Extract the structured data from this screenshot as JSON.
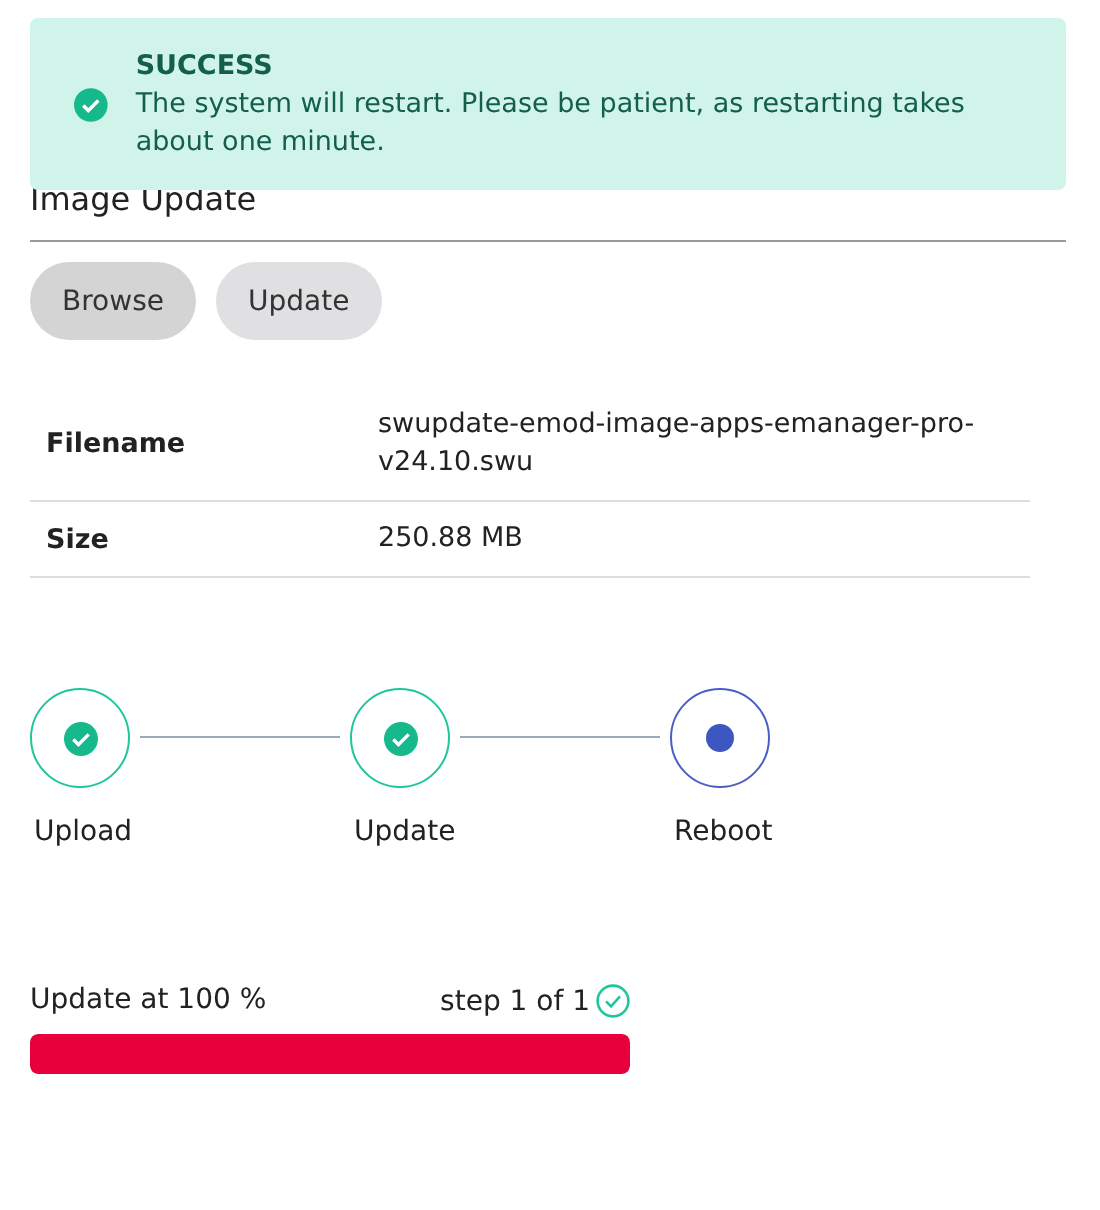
{
  "notification": {
    "title": "SUCCESS",
    "message": "The system will restart. Please be patient, as restarting takes about one minute."
  },
  "heading": "Image Update",
  "buttons": [
    {
      "label": "Browse",
      "pressed": true
    },
    {
      "label": "Update",
      "pressed": false
    }
  ],
  "file_info": [
    {
      "label": "Filename",
      "value": "swupdate-emod-image-apps-emanager-pro-v24.10.swu"
    },
    {
      "label": "Size",
      "value": "250.88 MB"
    }
  ],
  "steps": [
    {
      "label": "Upload",
      "completed": true
    },
    {
      "label": "Update",
      "completed": true
    },
    {
      "label": "Reboot",
      "completed": false
    }
  ],
  "progress": {
    "label": "Update at 100 %",
    "step": "step 1 of 1",
    "step_done": true,
    "level": 1
  }
}
